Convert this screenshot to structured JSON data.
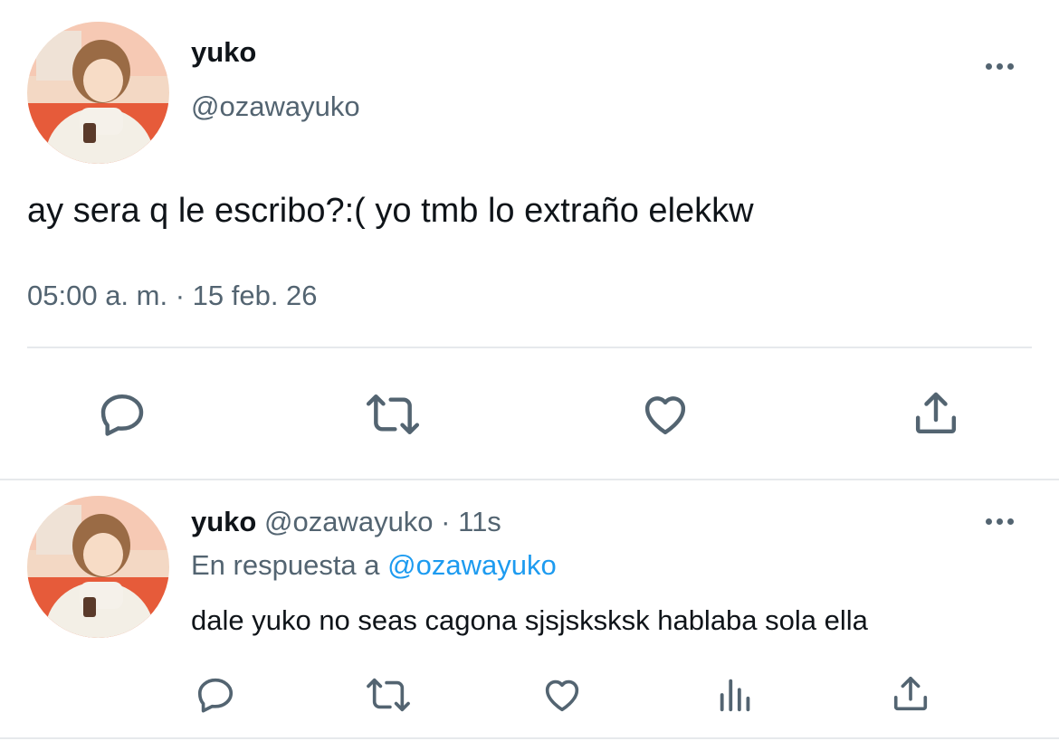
{
  "main_tweet": {
    "display_name": "yuko",
    "handle": "@ozawayuko",
    "text": "ay sera q le escribo?:( yo tmb lo extraño elekkw",
    "timestamp": "05:00 a. m. · 15 feb. 26",
    "actions": [
      "reply-icon",
      "retweet-icon",
      "like-icon",
      "share-icon"
    ]
  },
  "reply_tweet": {
    "display_name": "yuko",
    "handle": "@ozawayuko",
    "separator": "·",
    "time": "11s",
    "reply_prefix": "En respuesta a",
    "reply_to": "@ozawayuko",
    "text": "dale yuko no seas cagona sjsjsksksk hablaba sola ella",
    "actions": [
      "reply-icon",
      "retweet-icon",
      "like-icon",
      "views-icon",
      "share-icon"
    ]
  },
  "colors": {
    "accent": "#1d9bf0",
    "muted": "#536471",
    "text": "#0f1419",
    "divider": "#e6e9ec"
  }
}
